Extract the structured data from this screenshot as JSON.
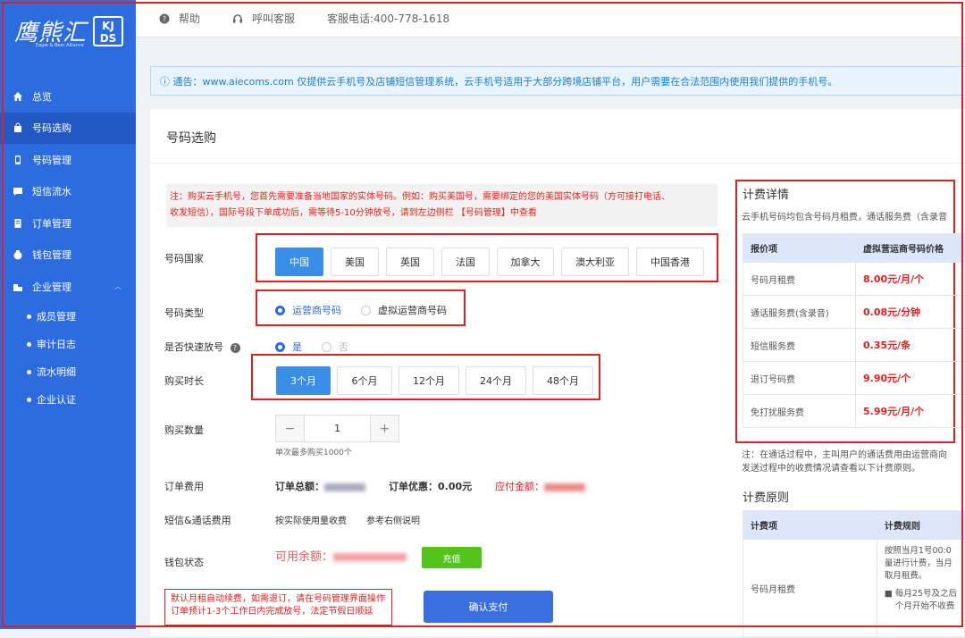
{
  "brand": {
    "logo_text": "鹰熊汇",
    "logo_sub": "Eagle & Bear Alliance",
    "badge": "KJ DS"
  },
  "sidebar": {
    "items": [
      {
        "label": "总览",
        "icon": "home-icon"
      },
      {
        "label": "号码选购",
        "icon": "bag-icon",
        "active": true
      },
      {
        "label": "号码管理",
        "icon": "phone-icon"
      },
      {
        "label": "短信流水",
        "icon": "message-icon"
      },
      {
        "label": "订单管理",
        "icon": "document-icon"
      },
      {
        "label": "钱包管理",
        "icon": "wallet-icon"
      },
      {
        "label": "企业管理",
        "icon": "building-icon",
        "expanded": true
      }
    ],
    "subitems": [
      "成员管理",
      "审计日志",
      "流水明细",
      "企业认证"
    ]
  },
  "topbar": {
    "help": "帮助",
    "call_service": "呼叫客服",
    "hotline": "客服电话:400-778-1618"
  },
  "notice": "ⓘ 通告：www.aiecoms.com 仅提供云手机号及店铺短信管理系统，云手机号适用于大部分跨境店铺平台，用户需要在合法范围内使用我们提供的手机号。",
  "page": {
    "title": "号码选购"
  },
  "warning": {
    "line1": "注：购买云手机号，您首先需要准备当地国家的实体号码。例如：购买美国号，需要绑定的您的美国实体号码（方可接打电话、",
    "line2": "收发短信），国际号段下单成功后，需等待5-10分钟放号，请到左边侧栏 【号码管理】中查看"
  },
  "form": {
    "country_label": "号码国家",
    "countries": [
      "中国",
      "美国",
      "英国",
      "法国",
      "加拿大",
      "澳大利亚",
      "中国香港"
    ],
    "type_label": "号码类型",
    "types": [
      "运营商号码",
      "虚拟运营商号码"
    ],
    "fast_label": "是否快速放号",
    "fast_yes": "是",
    "fast_no": "否",
    "duration_label": "购买时长",
    "durations": [
      "3个月",
      "6个月",
      "12个月",
      "24个月",
      "48个月"
    ],
    "qty_label": "购买数量",
    "qty_minus": "−",
    "qty_value": "1",
    "qty_plus": "+",
    "qty_hint": "单次最多购买1000个",
    "fee_label": "订单费用",
    "total_label": "订单总额：",
    "discount_label": "订单优惠：0.00元",
    "payable_label": "应付金额：",
    "sms_label": "短信&通话费用",
    "sms_value1": "按实际使用量收费",
    "sms_value2": "参考右侧说明",
    "wallet_label": "钱包状态",
    "balance_label": "可用余额：",
    "recharge": "充值",
    "auto_note1": "默认月租自动续费，如需退订，请在号码管理界面操作",
    "auto_note2": "订单预计1-3个工作日内完成放号，法定节假日顺延",
    "confirm": "确认支付"
  },
  "fees": {
    "title": "计费详情",
    "desc": "云手机号码均包含号码月租费，通话服务费（含录音",
    "headers": [
      "报价项",
      "虚拟营运商号码价格"
    ],
    "rows": [
      {
        "item": "号码月租费",
        "price": "8.00元/月/个"
      },
      {
        "item": "通话服务费(含录音)",
        "price": "0.08元/分钟"
      },
      {
        "item": "短信服务费",
        "price": "0.35元/条"
      },
      {
        "item": "退订号码费",
        "price": "9.90元/个"
      },
      {
        "item": "免打扰服务费",
        "price": "5.99元/月/个"
      }
    ],
    "note1": "注：在通话过程中，主叫用户的通话费用由运营商向",
    "note2": "发送过程中的收费情况请查看以下计费原则。"
  },
  "rules": {
    "title": "计费原则",
    "headers": [
      "计费项",
      "计费规则"
    ],
    "row_item": "号码月租费",
    "rule_lines": [
      "按照当月1号00:0",
      "量进行计费，当月",
      "取月租费。"
    ],
    "bullet1": "每月25号及之后",
    "bullet2": "个月开始不收费"
  }
}
